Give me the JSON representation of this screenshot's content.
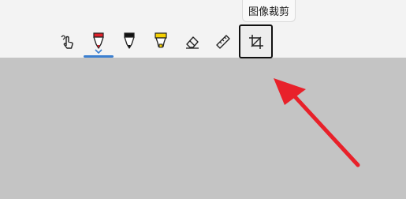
{
  "toolbar": {
    "tools": [
      {
        "icon": "touch-writing-icon"
      },
      {
        "icon": "ballpoint-pen-icon",
        "color": "#e0202a",
        "selected": true
      },
      {
        "icon": "pencil-icon",
        "color": "#111111"
      },
      {
        "icon": "highlighter-icon",
        "color": "#f5d000"
      },
      {
        "icon": "eraser-icon"
      },
      {
        "icon": "ruler-icon"
      },
      {
        "icon": "crop-icon",
        "hovered": true
      }
    ]
  },
  "tooltip": {
    "text": "图像裁剪"
  },
  "colors": {
    "toolbar_bg": "#f3f3f3",
    "canvas_bg": "#c4c4c4",
    "accent": "#3b7fd0",
    "annotation_arrow": "#e8212a"
  }
}
